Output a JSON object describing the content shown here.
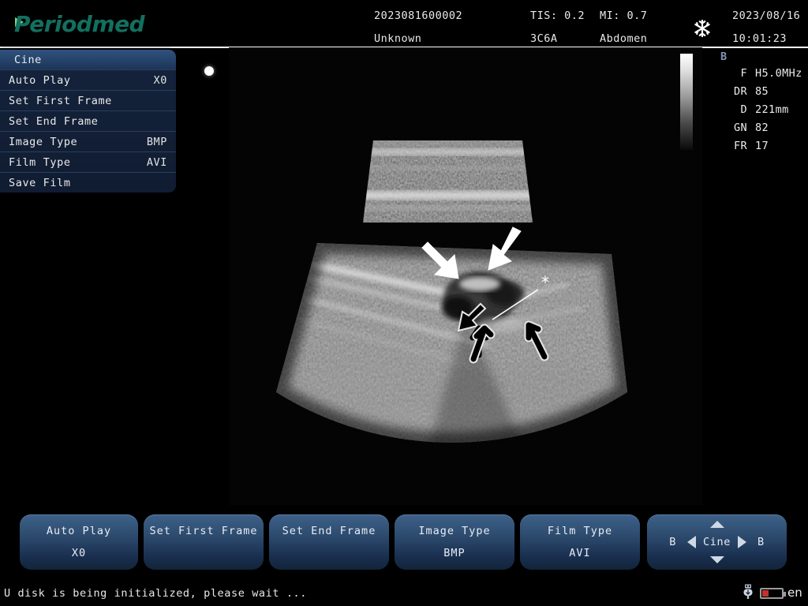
{
  "brand": {
    "name": "Periodmed"
  },
  "header": {
    "patient_id": "2023081600002",
    "patient_name": "Unknown",
    "tis": "TIS: 0.2",
    "probe": "3C6A",
    "mi": "MI: 0.7",
    "exam": "Abdomen",
    "date": "2023/08/16",
    "time": "10:01:23",
    "freeze_icon": "snowflake-icon"
  },
  "menu": {
    "title": "Cine",
    "items": [
      {
        "label": "Auto Play",
        "value": "X0"
      },
      {
        "label": "Set First Frame",
        "value": ""
      },
      {
        "label": "Set End Frame",
        "value": ""
      },
      {
        "label": "Image Type",
        "value": "BMP"
      },
      {
        "label": "Film Type",
        "value": "AVI"
      },
      {
        "label": "Save Film",
        "value": ""
      }
    ]
  },
  "params": {
    "mode": "B",
    "rows": [
      {
        "key": "F",
        "value": "H5.0MHz"
      },
      {
        "key": "DR",
        "value": "85"
      },
      {
        "key": "D",
        "value": "221mm"
      },
      {
        "key": "GN",
        "value": "82"
      },
      {
        "key": "FR",
        "value": "17"
      }
    ]
  },
  "image": {
    "modality": "ultrasound-b-mode",
    "annotations": [
      "white-arrow",
      "white-arrow",
      "black-arrow",
      "black-arrow",
      "asterisk-marker"
    ],
    "asterisk": "*",
    "orientation_marker": "orientation-dot"
  },
  "toolbar": {
    "buttons": [
      {
        "line1": "Auto Play",
        "line2": "X0"
      },
      {
        "line1": "Set First Frame",
        "line2": ""
      },
      {
        "line1": "Set End Frame",
        "line2": ""
      },
      {
        "line1": "Image Type",
        "line2": "BMP"
      },
      {
        "line1": "Film Type",
        "line2": "AVI"
      }
    ],
    "cine": {
      "left_label": "B",
      "center_label": "Cine",
      "right_label": "B"
    }
  },
  "status": {
    "message": "U disk is being initialized, please wait ...",
    "usb_icon": "usb-icon",
    "battery_icon": "battery-icon",
    "language": "en"
  },
  "colors": {
    "brand_green": "#12705f",
    "accent_blue": "#3e6189",
    "panel_dark": "#101c31",
    "battery_red": "#c0332e",
    "text": "#e9e9e9"
  }
}
